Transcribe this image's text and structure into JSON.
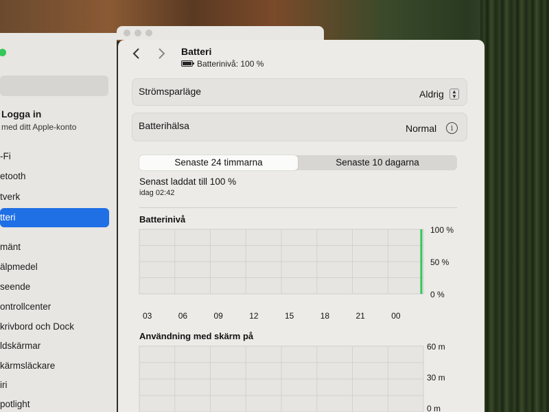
{
  "sidebar": {
    "account": {
      "name": "Logga in",
      "sub": "med ditt Apple-konto"
    },
    "items": [
      {
        "label": "-Fi"
      },
      {
        "label": "etooth"
      },
      {
        "label": "tverk"
      },
      {
        "label": "tteri",
        "selected": true
      },
      {
        "label": "mänt"
      },
      {
        "label": "älpmedel"
      },
      {
        "label": "seende"
      },
      {
        "label": "ontrollcenter"
      },
      {
        "label": "krivbord och Dock"
      },
      {
        "label": "ldskärmar"
      },
      {
        "label": "kärmsläckare"
      },
      {
        "label": "iri"
      },
      {
        "label": "potlight"
      }
    ]
  },
  "header": {
    "title": "Batteri",
    "subtitle": "Batterinivå: 100 %",
    "back_icon": "chevron-left-icon",
    "forward_icon": "chevron-right-icon"
  },
  "settings": {
    "power_saving": {
      "label": "Strömsparläge",
      "value": "Aldrig"
    },
    "health": {
      "label": "Batterihälsa",
      "value": "Normal"
    }
  },
  "tabs": [
    {
      "label": "Senaste 24 timmarna",
      "active": true
    },
    {
      "label": "Senaste 10 dagarna",
      "active": false
    }
  ],
  "last_charged": {
    "text": "Senast laddat till 100 %",
    "time": "idag 02:42"
  },
  "colors": {
    "accent": "#1f6fe5",
    "battery_bar": "#34c759",
    "panel": "#ecebe8"
  },
  "chart_data": [
    {
      "type": "bar",
      "title": "Batterinivå",
      "x_ticks": [
        "03",
        "06",
        "09",
        "12",
        "15",
        "18",
        "21",
        "00"
      ],
      "y_ticks": [
        "100 %",
        "50 %",
        "0 %"
      ],
      "ylim": [
        0,
        100
      ],
      "series": [
        {
          "values": [
            0,
            0,
            0,
            0,
            0,
            0,
            0,
            0,
            100
          ]
        }
      ]
    },
    {
      "type": "bar",
      "title": "Användning med skärm på",
      "y_ticks": [
        "60 m",
        "30 m",
        "0 m"
      ],
      "ylim": [
        0,
        60
      ]
    }
  ]
}
